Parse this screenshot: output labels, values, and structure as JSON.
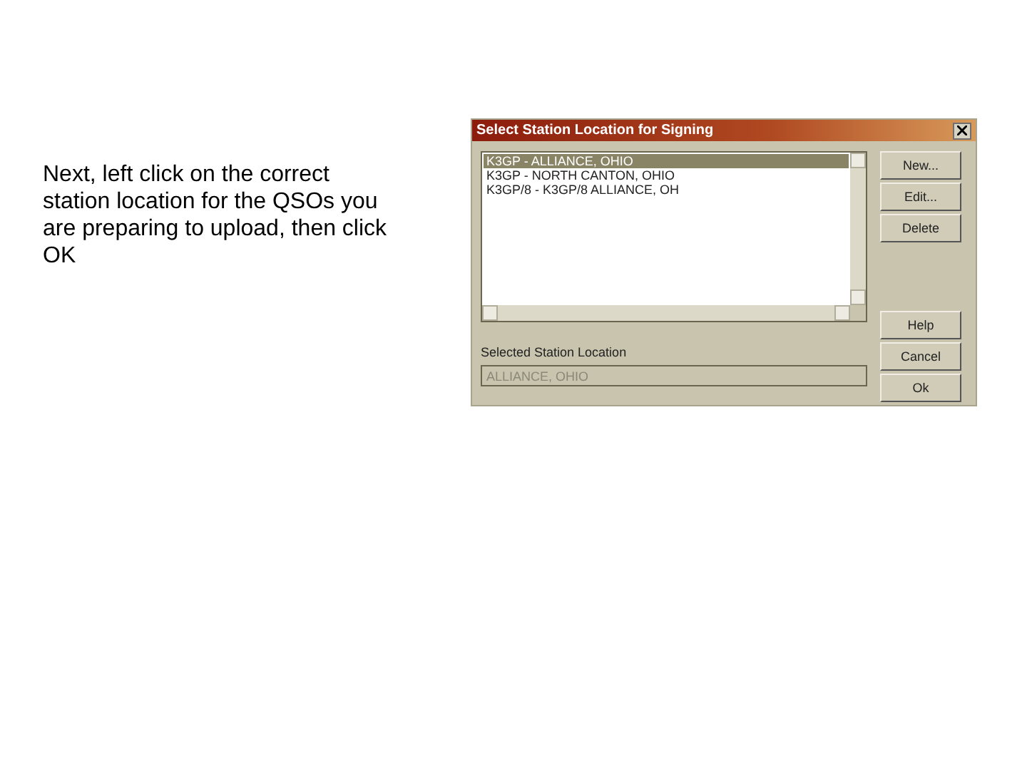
{
  "slide": {
    "instruction": "Next, left click on the correct station location for the QSOs you are preparing to upload, then click OK"
  },
  "dialog": {
    "title": "Select Station Location for Signing",
    "locations": [
      {
        "label": "K3GP - ALLIANCE, OHIO",
        "selected": true
      },
      {
        "label": "K3GP - NORTH CANTON, OHIO",
        "selected": false
      },
      {
        "label": "K3GP/8 - K3GP/8 ALLIANCE, OH",
        "selected": false
      }
    ],
    "top_buttons": [
      "New...",
      "Edit...",
      "Delete"
    ],
    "bottom_buttons": [
      "Help",
      "Cancel",
      "Ok"
    ],
    "selected_label": "Selected Station Location",
    "selected_field": {
      "value": "ALLIANCE, OHIO",
      "disabled": true
    }
  }
}
